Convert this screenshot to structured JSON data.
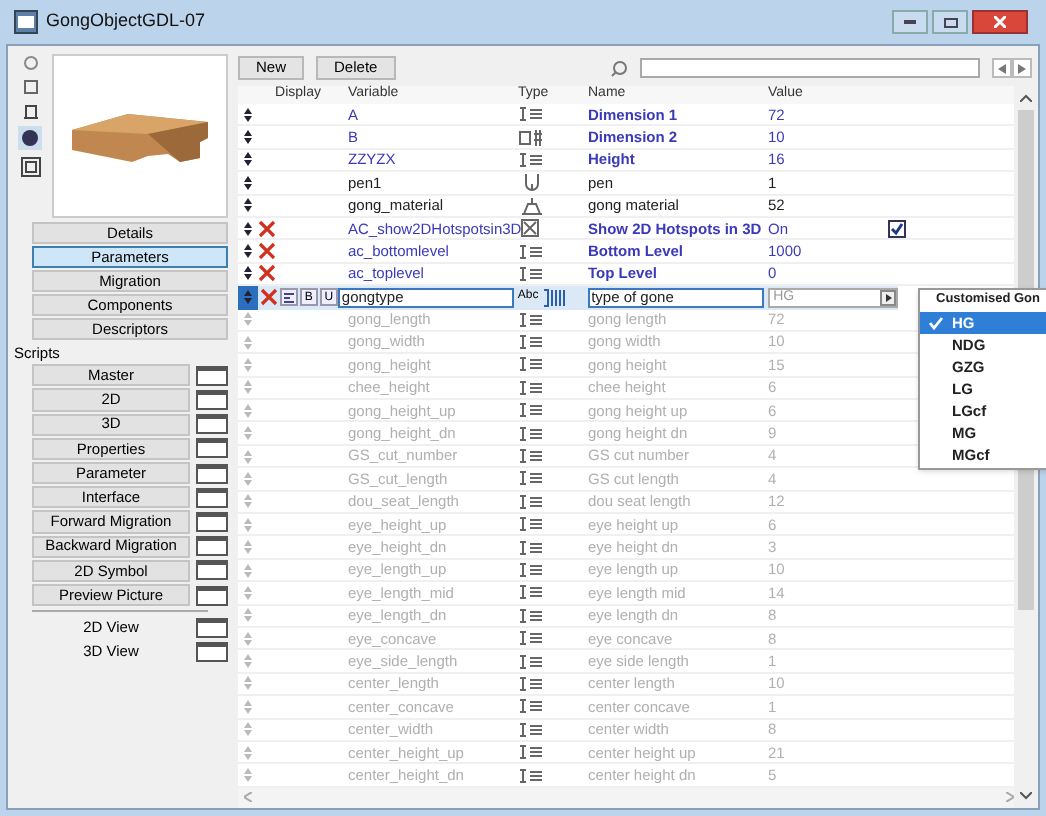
{
  "window": {
    "title": "GongObjectGDL-07"
  },
  "toolbar": {
    "buttons": [
      "New",
      "Delete"
    ]
  },
  "pages": [
    {
      "label": "Details",
      "selected": false
    },
    {
      "label": "Parameters",
      "selected": true
    },
    {
      "label": "Migration",
      "selected": false
    },
    {
      "label": "Components",
      "selected": false
    },
    {
      "label": "Descriptors",
      "selected": false
    }
  ],
  "scripts_label": "Scripts",
  "scripts": [
    "Master",
    "2D",
    "3D",
    "Properties",
    "Parameter",
    "Interface",
    "Forward Migration",
    "Backward Migration",
    "2D Symbol",
    "Preview Picture"
  ],
  "views": [
    "2D View",
    "3D View"
  ],
  "table": {
    "columns": [
      "Display",
      "Variable",
      "Type",
      "Name",
      "Value"
    ],
    "rows": [
      {
        "variable": "A",
        "type": {
          "kind": "length"
        },
        "name": "Dimension 1",
        "value": "72",
        "kind": "param",
        "hidden": false,
        "selected": false
      },
      {
        "variable": "B",
        "type": {
          "kind": "integer"
        },
        "name": "Dimension 2",
        "value": "10",
        "kind": "param",
        "hidden": false,
        "selected": false
      },
      {
        "variable": "ZZYZX",
        "type": {
          "kind": "length"
        },
        "name": "Height",
        "value": "16",
        "kind": "param",
        "hidden": false,
        "selected": false
      },
      {
        "variable": "pen1",
        "type": {
          "kind": "pen"
        },
        "name": "pen",
        "value": "1",
        "kind": "plain",
        "hidden": false,
        "selected": false
      },
      {
        "variable": "gong_material",
        "type": {
          "kind": "material"
        },
        "name": "gong material",
        "value": "52",
        "kind": "plain",
        "hidden": false,
        "selected": false
      },
      {
        "variable": "AC_show2DHotspotsin3D",
        "type": {
          "kind": "boolean"
        },
        "name": "Show 2D Hotspots in 3D",
        "value": "On",
        "kind": "param",
        "hidden": true,
        "selected": false,
        "checked": true
      },
      {
        "variable": "ac_bottomlevel",
        "type": {
          "kind": "length"
        },
        "name": "Bottom Level",
        "value": "1000",
        "kind": "param",
        "hidden": true,
        "selected": false
      },
      {
        "variable": "ac_toplevel",
        "type": {
          "kind": "length"
        },
        "name": "Top Level",
        "value": "0",
        "kind": "param",
        "hidden": true,
        "selected": false
      },
      {
        "variable": "gongtype",
        "type": {
          "kind": "string"
        },
        "type_label": "Abc",
        "name": "type of gone",
        "value": "HG",
        "kind": "plain",
        "hidden": true,
        "selected": true,
        "bold_label": "B",
        "underline_label": "U"
      },
      {
        "variable": "gong_length",
        "type": {
          "kind": "length"
        },
        "name": "gong length",
        "value": "72",
        "kind": "disabled",
        "hidden": false,
        "selected": false
      },
      {
        "variable": "gong_width",
        "type": {
          "kind": "length"
        },
        "name": "gong width",
        "value": "10",
        "kind": "disabled",
        "hidden": false,
        "selected": false
      },
      {
        "variable": "gong_height",
        "type": {
          "kind": "length"
        },
        "name": "gong height",
        "value": "15",
        "kind": "disabled",
        "hidden": false,
        "selected": false
      },
      {
        "variable": "chee_height",
        "type": {
          "kind": "length"
        },
        "name": "chee height",
        "value": "6",
        "kind": "disabled",
        "hidden": false,
        "selected": false
      },
      {
        "variable": "gong_height_up",
        "type": {
          "kind": "length"
        },
        "name": "gong height up",
        "value": "6",
        "kind": "disabled",
        "hidden": false,
        "selected": false
      },
      {
        "variable": "gong_height_dn",
        "type": {
          "kind": "length"
        },
        "name": "gong height dn",
        "value": "9",
        "kind": "disabled",
        "hidden": false,
        "selected": false
      },
      {
        "variable": "GS_cut_number",
        "type": {
          "kind": "length"
        },
        "name": "GS cut number",
        "value": "4",
        "kind": "disabled",
        "hidden": false,
        "selected": false
      },
      {
        "variable": "GS_cut_length",
        "type": {
          "kind": "length"
        },
        "name": "GS cut length",
        "value": "4",
        "kind": "disabled",
        "hidden": false,
        "selected": false
      },
      {
        "variable": "dou_seat_length",
        "type": {
          "kind": "length"
        },
        "name": "dou seat length",
        "value": "12",
        "kind": "disabled",
        "hidden": false,
        "selected": false
      },
      {
        "variable": "eye_height_up",
        "type": {
          "kind": "length"
        },
        "name": "eye height up",
        "value": "6",
        "kind": "disabled",
        "hidden": false,
        "selected": false
      },
      {
        "variable": "eye_height_dn",
        "type": {
          "kind": "length"
        },
        "name": "eye height dn",
        "value": "3",
        "kind": "disabled",
        "hidden": false,
        "selected": false
      },
      {
        "variable": "eye_length_up",
        "type": {
          "kind": "length"
        },
        "name": "eye length up",
        "value": "10",
        "kind": "disabled",
        "hidden": false,
        "selected": false
      },
      {
        "variable": "eye_length_mid",
        "type": {
          "kind": "length"
        },
        "name": "eye length mid",
        "value": "14",
        "kind": "disabled",
        "hidden": false,
        "selected": false
      },
      {
        "variable": "eye_length_dn",
        "type": {
          "kind": "length"
        },
        "name": "eye length dn",
        "value": "8",
        "kind": "disabled",
        "hidden": false,
        "selected": false
      },
      {
        "variable": "eye_concave",
        "type": {
          "kind": "length"
        },
        "name": "eye concave",
        "value": "8",
        "kind": "disabled",
        "hidden": false,
        "selected": false
      },
      {
        "variable": "eye_side_length",
        "type": {
          "kind": "length"
        },
        "name": "eye side length",
        "value": "1",
        "kind": "disabled",
        "hidden": false,
        "selected": false
      },
      {
        "variable": "center_length",
        "type": {
          "kind": "length"
        },
        "name": "center length",
        "value": "10",
        "kind": "disabled",
        "hidden": false,
        "selected": false
      },
      {
        "variable": "center_concave",
        "type": {
          "kind": "length"
        },
        "name": "center concave",
        "value": "1",
        "kind": "disabled",
        "hidden": false,
        "selected": false
      },
      {
        "variable": "center_width",
        "type": {
          "kind": "length"
        },
        "name": "center width",
        "value": "8",
        "kind": "disabled",
        "hidden": false,
        "selected": false
      },
      {
        "variable": "center_height_up",
        "type": {
          "kind": "length"
        },
        "name": "center height up",
        "value": "21",
        "kind": "disabled",
        "hidden": false,
        "selected": false
      },
      {
        "variable": "center_height_dn",
        "type": {
          "kind": "length"
        },
        "name": "center height dn",
        "value": "5",
        "kind": "disabled",
        "hidden": false,
        "selected": false
      }
    ]
  },
  "dropdown": {
    "title": "Customised Gon",
    "items": [
      {
        "label": "HG",
        "selected": true
      },
      {
        "label": "NDG",
        "selected": false
      },
      {
        "label": "GZG",
        "selected": false
      },
      {
        "label": "LG",
        "selected": false
      },
      {
        "label": "LGcf",
        "selected": false
      },
      {
        "label": "MG",
        "selected": false
      },
      {
        "label": "MGcf",
        "selected": false
      }
    ]
  }
}
